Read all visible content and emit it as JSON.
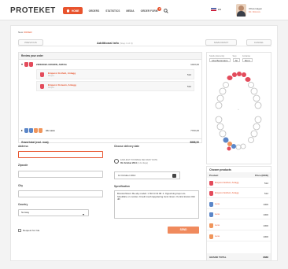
{
  "header": {
    "logo": "PROTEKET",
    "nav": [
      {
        "label": "HOME",
        "active": true
      },
      {
        "label": "ORDERS"
      },
      {
        "label": "STATISTICS"
      },
      {
        "label": "MEDIA"
      },
      {
        "label": "ORDER FORM",
        "badge": "2"
      }
    ],
    "lang": "EN",
    "user_name": "Olivia Hagen",
    "user_sub": "Kl.: Kit nnn"
  },
  "breadcrumb": {
    "prefix": "New",
    "accent": "ORDER"
  },
  "stepbar": {
    "prev_label": "PREVIOUS",
    "title": "Additional info",
    "subtitle": "(Step 3 of 3)",
    "save_label": "SAVE DRAFT",
    "cancel_label": "CANCEL"
  },
  "review": {
    "heading": "Review your order",
    "groups": [
      {
        "label": "ZIRKONIA CROWN, ANTAG",
        "price": "1023,00",
        "items": [
          {
            "name": "Emperor Estheti, Antagg",
            "desc": "Ampra",
            "price": "512"
          },
          {
            "name": "Emperor Esteem, Antagg",
            "desc": "Ampra",
            "price": "512"
          }
        ]
      },
      {
        "label": "Ab Lene",
        "price": "7700,00"
      }
    ],
    "grand_label": "Grand total (excl. moa)",
    "grand_price": "8888,00"
  },
  "form": {
    "address_label": "Address",
    "address_value": "",
    "zipcode_label": "Zipcode",
    "city_label": "City",
    "country_label": "Country",
    "country_value": "Norway",
    "delivery_label": "Choose delivery date",
    "delivery_hint": "EARLIEST POSSIBLE DELIVERY DATE",
    "delivery_date_text": "09. October 2014",
    "delivery_days": "(in 14 days)",
    "date_value": "12 October 2014",
    "spec_label": "Specification",
    "spec_text": "Bruxismhistori. Be aby modell. 1 ISO til 13.08. 2. Opportning trepn ulo. Shoulfahe on modres. Kmetli mesh tappelering trunk rlorem. Kontrol kramsi 324 dill",
    "checkbox_label": "Request for ride",
    "send_label": "SEND"
  },
  "chart": {
    "col1_label": "Teknik (oferrentio)",
    "col1_value": "Like Bensmans",
    "col2_label": "Step",
    "col2_value": "All",
    "col3_label": "Contarles",
    "col3_value": "Mont"
  },
  "chosen": {
    "title": "Chosen products",
    "col_product": "Product",
    "col_price": "Price (NOK)",
    "rows": [
      {
        "name": "Emperor Estheti, Antagg",
        "price": "512",
        "color": "red"
      },
      {
        "name": "Emperor Estheti, Antagg",
        "price": "512",
        "color": "red"
      },
      {
        "name": "Lene",
        "price": "1300",
        "color": "blue"
      },
      {
        "name": "Lene",
        "price": "1300",
        "color": "blue"
      },
      {
        "name": "Lene",
        "price": "1300",
        "color": "orange"
      },
      {
        "name": "Lene",
        "price": "1300",
        "color": "orange"
      }
    ],
    "total_label": "GRAND TOTAL",
    "total_value": "8888"
  },
  "colors": {
    "accent": "#e8532d",
    "red_tooth": "#e34b5b",
    "blue_tooth": "#5b86c8",
    "orange_tooth": "#f0955b"
  }
}
